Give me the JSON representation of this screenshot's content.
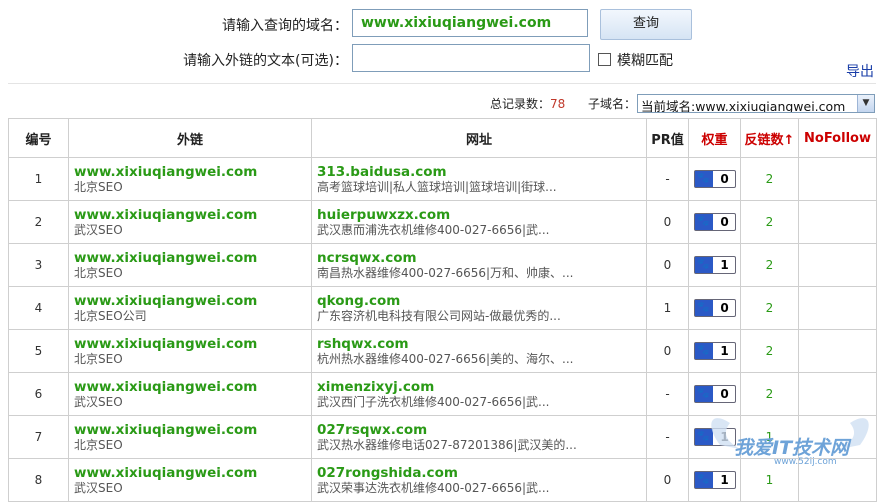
{
  "form": {
    "domain_label": "请输入查询的域名：",
    "domain_value": "www.xixiuqiangwei.com",
    "text_label": "请输入外链的文本(可选)：",
    "text_value": "",
    "query_button": "查询",
    "fuzzy_label": "模糊匹配",
    "export_link": "导出"
  },
  "stats": {
    "total_label": "总记录数：",
    "total_count": "78",
    "subdomain_label": "子域名：",
    "subdomain_selected": "当前域名:www.xixiuqiangwei.com"
  },
  "table": {
    "headers": [
      "编号",
      "外链",
      "网址",
      "PR值",
      "权重",
      "反链数↑",
      "NoFollow"
    ],
    "rows": [
      {
        "num": "1",
        "link": "www.xixiuqiangwei.com",
        "anchor": "北京SEO",
        "url": "313.baidusa.com",
        "title": "高考篮球培训|私人篮球培训|篮球培训|街球...",
        "pr": "-",
        "weight": "0",
        "backlinks": "2",
        "nofollow": ""
      },
      {
        "num": "2",
        "link": "www.xixiuqiangwei.com",
        "anchor": "武汉SEO",
        "url": "huierpuwxzx.com",
        "title": "武汉惠而浦洗衣机维修400-027-6656|武...",
        "pr": "0",
        "weight": "0",
        "backlinks": "2",
        "nofollow": ""
      },
      {
        "num": "3",
        "link": "www.xixiuqiangwei.com",
        "anchor": "北京SEO",
        "url": "ncrsqwx.com",
        "title": "南昌热水器维修400-027-6656|万和、帅康、...",
        "pr": "0",
        "weight": "1",
        "backlinks": "2",
        "nofollow": ""
      },
      {
        "num": "4",
        "link": "www.xixiuqiangwei.com",
        "anchor": "北京SEO公司",
        "url": "qkong.com",
        "title": "广东容济机电科技有限公司网站-做最优秀的...",
        "pr": "1",
        "weight": "0",
        "backlinks": "2",
        "nofollow": ""
      },
      {
        "num": "5",
        "link": "www.xixiuqiangwei.com",
        "anchor": "北京SEO",
        "url": "rshqwx.com",
        "title": "杭州热水器维修400-027-6656|美的、海尔、...",
        "pr": "0",
        "weight": "1",
        "backlinks": "2",
        "nofollow": ""
      },
      {
        "num": "6",
        "link": "www.xixiuqiangwei.com",
        "anchor": "武汉SEO",
        "url": "ximenzixyj.com",
        "title": "武汉西门子洗衣机维修400-027-6656|武...",
        "pr": "-",
        "weight": "0",
        "backlinks": "2",
        "nofollow": ""
      },
      {
        "num": "7",
        "link": "www.xixiuqiangwei.com",
        "anchor": "北京SEO",
        "url": "027rsqwx.com",
        "title": "武汉热水器维修电话027-87201386|武汉美的...",
        "pr": "-",
        "weight": "1",
        "backlinks": "1",
        "nofollow": ""
      },
      {
        "num": "8",
        "link": "www.xixiuqiangwei.com",
        "anchor": "武汉SEO",
        "url": "027rongshida.com",
        "title": "武汉荣事达洗衣机维修400-027-6656|武...",
        "pr": "0",
        "weight": "1",
        "backlinks": "1",
        "nofollow": ""
      }
    ]
  },
  "watermark": {
    "text": "我爱IT技术网",
    "url": "www.52ij.com"
  },
  "icons": {
    "weight_badge": "baidu-paw-icon",
    "dropdown": "chevron-down-icon"
  },
  "colors": {
    "link_green": "#2a9a16",
    "header_red": "#cc0000",
    "count_red": "#c0392b",
    "paw_blue": "#2b59c6"
  }
}
